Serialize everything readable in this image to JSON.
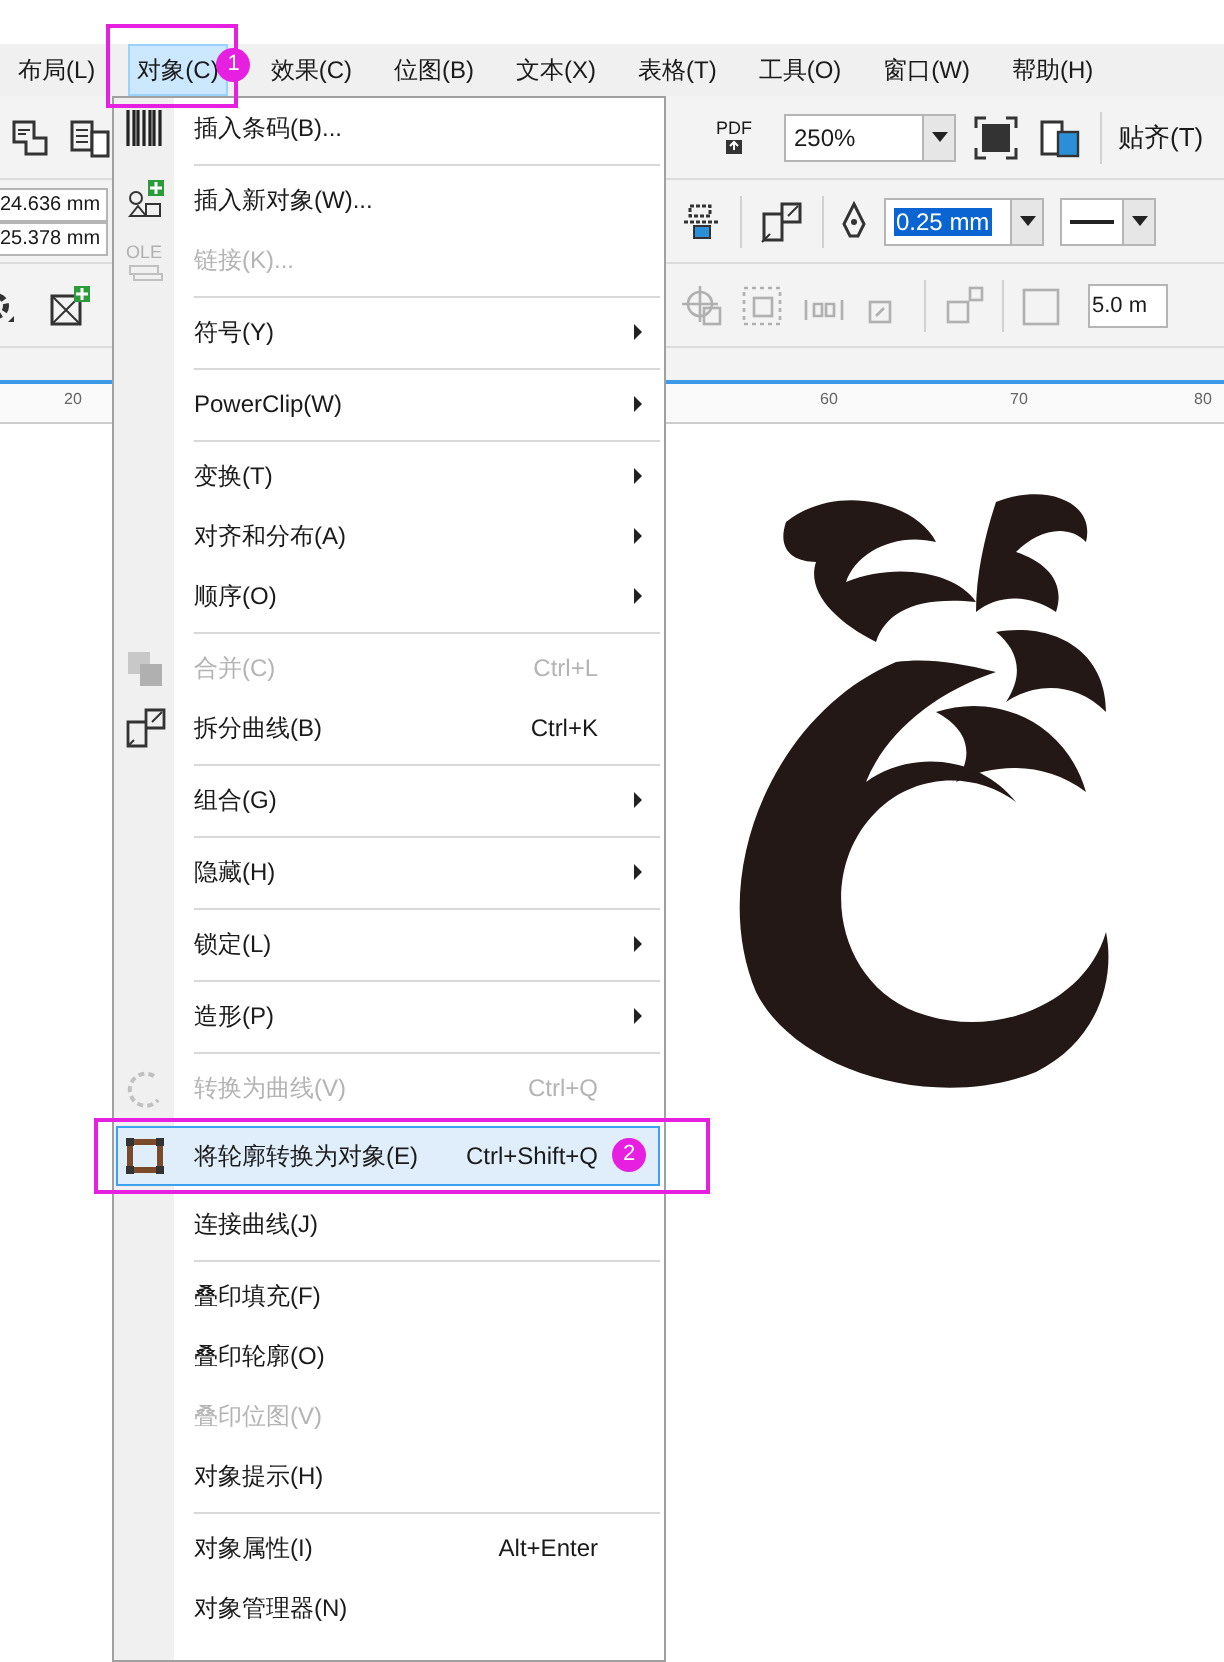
{
  "menubar": [
    {
      "label": "布局(L)",
      "selected": false
    },
    {
      "label": "对象(C)",
      "selected": true
    },
    {
      "label": "效果(C)",
      "selected": false
    },
    {
      "label": "位图(B)",
      "selected": false
    },
    {
      "label": "文本(X)",
      "selected": false
    },
    {
      "label": "表格(T)",
      "selected": false
    },
    {
      "label": "工具(O)",
      "selected": false
    },
    {
      "label": "窗口(W)",
      "selected": false
    },
    {
      "label": "帮助(H)",
      "selected": false
    }
  ],
  "toolbar": {
    "zoom": "250%",
    "snap": "贴齐(T)",
    "pdf": "PDF"
  },
  "property_bar": {
    "x_field": "24.636 mm",
    "y_field": "25.378 mm",
    "outline_width": "0.25 mm"
  },
  "toolbar_3": {
    "offset_field": "5.0 m"
  },
  "ruler": {
    "labels": [
      "20",
      "60",
      "70",
      "80"
    ]
  },
  "menu": [
    {
      "kind": "item",
      "label": "插入条码(B)...",
      "submenu": false,
      "disabled": false,
      "selected": false
    },
    {
      "kind": "separator"
    },
    {
      "kind": "item",
      "label": "插入新对象(W)...",
      "submenu": false,
      "disabled": false,
      "selected": false
    },
    {
      "kind": "item",
      "label": "链接(K)...",
      "icon_text": "OLE",
      "submenu": false,
      "disabled": true,
      "selected": false
    },
    {
      "kind": "separator"
    },
    {
      "kind": "item",
      "label": "符号(Y)",
      "submenu": true,
      "disabled": false,
      "selected": false
    },
    {
      "kind": "separator"
    },
    {
      "kind": "item",
      "label": "PowerClip(W)",
      "submenu": true,
      "disabled": false,
      "selected": false
    },
    {
      "kind": "separator"
    },
    {
      "kind": "item",
      "label": "变换(T)",
      "submenu": true,
      "disabled": false,
      "selected": false
    },
    {
      "kind": "item",
      "label": "对齐和分布(A)",
      "submenu": true,
      "disabled": false,
      "selected": false
    },
    {
      "kind": "item",
      "label": "顺序(O)",
      "submenu": true,
      "disabled": false,
      "selected": false
    },
    {
      "kind": "separator"
    },
    {
      "kind": "item",
      "label": "合并(C)",
      "shortcut": "Ctrl+L",
      "submenu": false,
      "disabled": true,
      "selected": false
    },
    {
      "kind": "item",
      "label": "拆分曲线(B)",
      "shortcut": "Ctrl+K",
      "submenu": false,
      "disabled": false,
      "selected": false
    },
    {
      "kind": "separator"
    },
    {
      "kind": "item",
      "label": "组合(G)",
      "submenu": true,
      "disabled": false,
      "selected": false
    },
    {
      "kind": "separator"
    },
    {
      "kind": "item",
      "label": "隐藏(H)",
      "submenu": true,
      "disabled": false,
      "selected": false
    },
    {
      "kind": "separator"
    },
    {
      "kind": "item",
      "label": "锁定(L)",
      "submenu": true,
      "disabled": false,
      "selected": false
    },
    {
      "kind": "separator"
    },
    {
      "kind": "item",
      "label": "造形(P)",
      "submenu": true,
      "disabled": false,
      "selected": false
    },
    {
      "kind": "separator"
    },
    {
      "kind": "item",
      "label": "转换为曲线(V)",
      "shortcut": "Ctrl+Q",
      "submenu": false,
      "disabled": true,
      "selected": false
    },
    {
      "kind": "item",
      "label": "将轮廓转换为对象(E)",
      "shortcut": "Ctrl+Shift+Q",
      "submenu": false,
      "disabled": false,
      "selected": true
    },
    {
      "kind": "item",
      "label": "连接曲线(J)",
      "submenu": false,
      "disabled": false,
      "selected": false
    },
    {
      "kind": "separator"
    },
    {
      "kind": "item",
      "label": "叠印填充(F)",
      "submenu": false,
      "disabled": false,
      "selected": false
    },
    {
      "kind": "item",
      "label": "叠印轮廓(O)",
      "submenu": false,
      "disabled": false,
      "selected": false
    },
    {
      "kind": "item",
      "label": "叠印位图(V)",
      "submenu": false,
      "disabled": true,
      "selected": false
    },
    {
      "kind": "item",
      "label": "对象提示(H)",
      "submenu": false,
      "disabled": false,
      "selected": false
    },
    {
      "kind": "separator"
    },
    {
      "kind": "item",
      "label": "对象属性(I)",
      "shortcut": "Alt+Enter",
      "submenu": false,
      "disabled": false,
      "selected": false
    },
    {
      "kind": "item",
      "label": "对象管理器(N)",
      "submenu": false,
      "disabled": false,
      "selected": false
    }
  ],
  "annotations": [
    {
      "number": "1"
    },
    {
      "number": "2"
    }
  ]
}
